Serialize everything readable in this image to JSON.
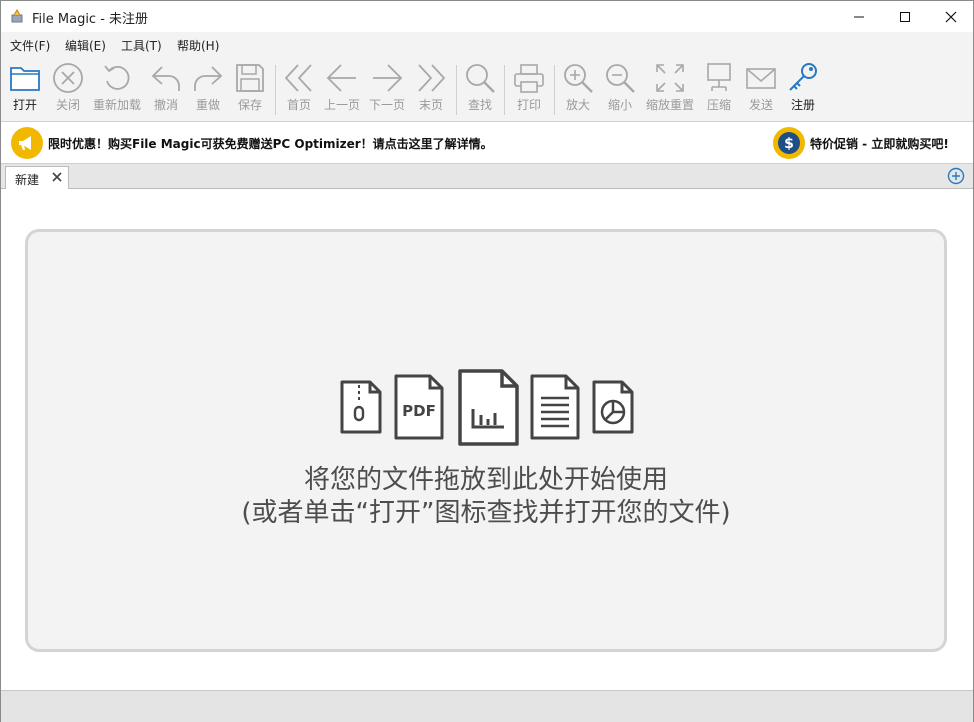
{
  "window": {
    "title": "File Magic - 未注册"
  },
  "menu": [
    {
      "label": "文件(F)"
    },
    {
      "label": "编辑(E)"
    },
    {
      "label": "工具(T)"
    },
    {
      "label": "帮助(H)"
    }
  ],
  "toolbar": {
    "open": "打开",
    "close": "关闭",
    "reload": "重新加载",
    "undo": "撤消",
    "redo": "重做",
    "save": "保存",
    "first": "首页",
    "prev": "上一页",
    "next": "下一页",
    "last": "末页",
    "find": "查找",
    "print": "打印",
    "zoom_in": "放大",
    "zoom_out": "缩小",
    "zoom_reset": "缩放重置",
    "compress": "压缩",
    "send": "发送",
    "register": "注册"
  },
  "promo": {
    "left_text": "限时优惠！购买File Magic可获免费赠送PC Optimizer！请点击这里了解详情。",
    "right_text": "特价促销 - 立即就购买吧!",
    "icon_color": "#f2b800"
  },
  "tabs": [
    {
      "label": "新建"
    }
  ],
  "dropzone": {
    "line1": "将您的文件拖放到此处开始使用",
    "line2": "(或者单击“打开”图标查找并打开您的文件)",
    "pdf_label": "PDF"
  }
}
